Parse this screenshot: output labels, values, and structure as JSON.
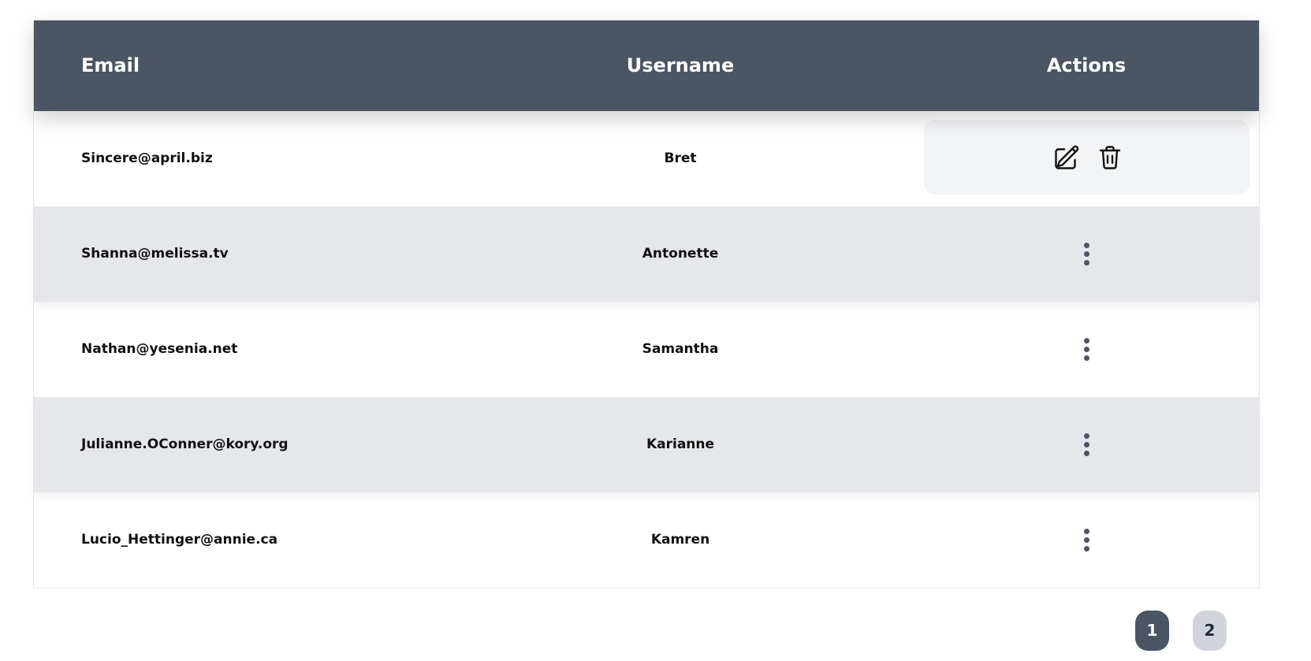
{
  "table": {
    "headers": {
      "email": "Email",
      "username": "Username",
      "actions": "Actions"
    },
    "rows": [
      {
        "email": "Sincere@april.biz",
        "username": "Bret",
        "actions_expanded": true
      },
      {
        "email": "Shanna@melissa.tv",
        "username": "Antonette",
        "actions_expanded": false
      },
      {
        "email": "Nathan@yesenia.net",
        "username": "Samantha",
        "actions_expanded": false
      },
      {
        "email": "Julianne.OConner@kory.org",
        "username": "Karianne",
        "actions_expanded": false
      },
      {
        "email": "Lucio_Hettinger@annie.ca",
        "username": "Kamren",
        "actions_expanded": false
      }
    ],
    "row_actions": {
      "edit_icon": "pencil-square-icon",
      "delete_icon": "trash-icon",
      "menu_icon": "kebab-menu-icon"
    }
  },
  "pagination": {
    "pages": [
      "1",
      "2"
    ],
    "current": "1"
  },
  "colors": {
    "header_bg": "#4b5563",
    "alt_row_bg": "#e5e7eb",
    "active_page_bg": "#4b5563",
    "inactive_page_bg": "#d1d5db",
    "actions_panel_bg": "#f3f4f6"
  }
}
